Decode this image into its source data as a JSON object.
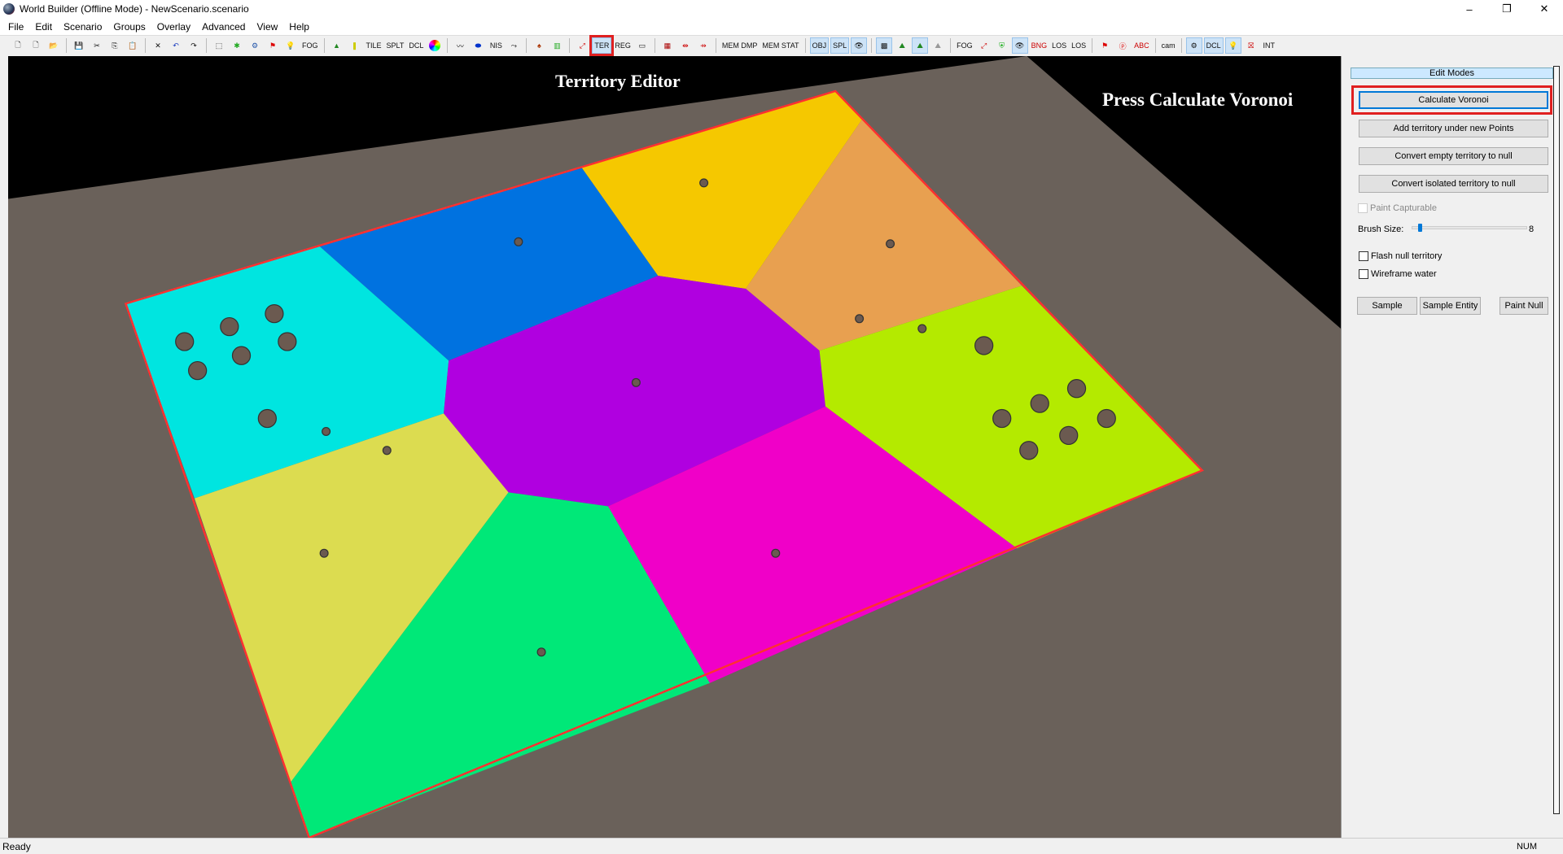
{
  "window": {
    "title": "World Builder (Offline Mode) - NewScenario.scenario",
    "minimize": "–",
    "restore": "❐",
    "close": "✕"
  },
  "menu": [
    "File",
    "Edit",
    "Scenario",
    "Groups",
    "Overlay",
    "Advanced",
    "View",
    "Help"
  ],
  "toolbar": {
    "fog": "FOG",
    "tile": "TILE",
    "splt": "SPLT",
    "dcl": "DCL",
    "nis": "NIS",
    "ter": "TER",
    "reg": "REG",
    "mem_dmp": "MEM DMP",
    "mem_stat": "MEM STAT",
    "obj": "OBJ",
    "spl": "SPL",
    "fog_vis": "FOG",
    "los1": "LOS",
    "los2": "LOS",
    "cam": "cam",
    "dcl_vis": "DCL",
    "int": "INT",
    "bng": "BNG",
    "abc": "ABC"
  },
  "viewport": {
    "editor_label": "Territory Editor",
    "instruction": "Press Calculate Voronoi",
    "territory_colors": {
      "cyan": "#00e5e0",
      "blue": "#0072e0",
      "gold": "#f5c800",
      "orange": "#e8a050",
      "purple": "#b000e0",
      "lime": "#b4ea00",
      "khaki": "#dcdc50",
      "green": "#00e878",
      "magenta": "#f000c8",
      "ground": "#6a615a",
      "border": "#ff3030"
    }
  },
  "panel": {
    "section": "Edit Modes",
    "calculate": "Calculate Voronoi",
    "add_territory": "Add territory under new Points",
    "convert_empty": "Convert empty territory to null",
    "convert_isolated": "Convert isolated territory to null",
    "paint_capturable": "Paint Capturable",
    "brush_label": "Brush Size:",
    "brush_value": "8",
    "brush_fraction": 0.05,
    "flash_null": "Flash null territory",
    "wireframe": "Wireframe water",
    "sample": "Sample",
    "sample_entity": "Sample Entity",
    "paint_null": "Paint Null"
  },
  "status": {
    "text": "Ready",
    "num": "NUM"
  }
}
